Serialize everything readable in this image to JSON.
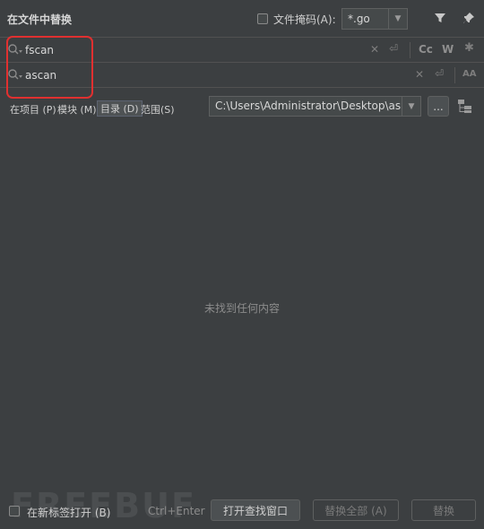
{
  "header": {
    "title": "在文件中替换",
    "file_mask_label": "文件掩码(A):",
    "file_mask_value": "*.go"
  },
  "search": {
    "value": "fscan",
    "case_label": "Cc",
    "word_label": "W"
  },
  "replace": {
    "value": "ascan",
    "preserve_case_label": "AA"
  },
  "scopes": [
    {
      "label": "在项目 (P)"
    },
    {
      "label": "模块 (M)"
    },
    {
      "label": "目录 (D)"
    },
    {
      "label": "范围(S)"
    }
  ],
  "directory": {
    "value": "C:\\Users\\Administrator\\Desktop\\as",
    "browse_label": "..."
  },
  "results": {
    "empty_text": "未找到任何内容"
  },
  "footer": {
    "new_tab_label": "在新标签打开 (B)",
    "shortcut": "Ctrl+Enter",
    "open_find_window": "打开查找窗口",
    "replace_all": "替换全部 (A)",
    "replace": "替换"
  },
  "watermark": "FREEBUF"
}
